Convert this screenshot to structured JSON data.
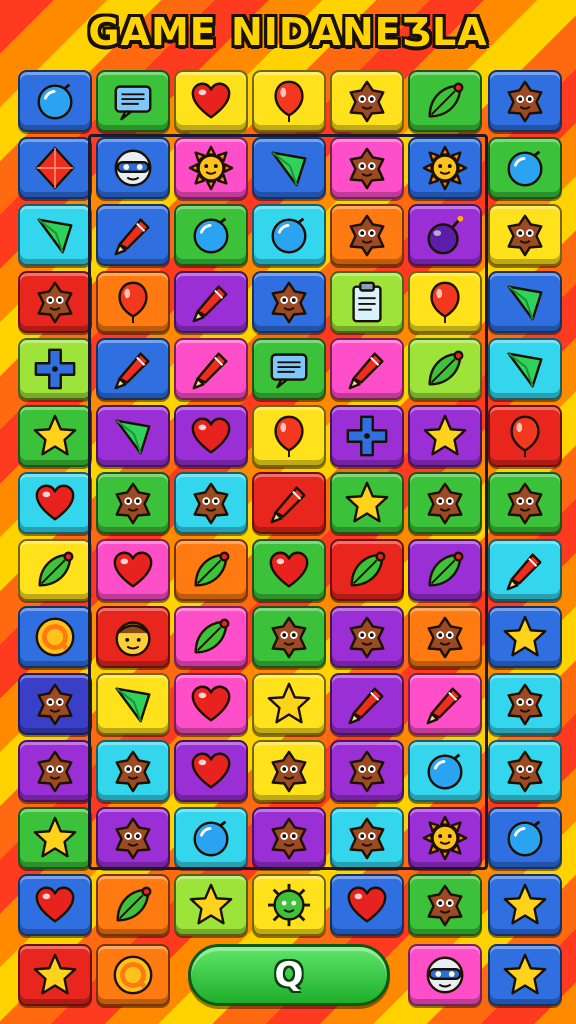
{
  "header": {
    "title": "GAME NIDANEƷLA"
  },
  "colors": {
    "blue": "#2f6fe0",
    "green": "#3cc23a",
    "yellow": "#ffe21c",
    "red": "#e8261e",
    "orange": "#ff7a10",
    "cyan": "#34d6ee",
    "pink": "#ff4fc8",
    "purple": "#9b2fd6",
    "lime": "#9ee33a",
    "navy": "#3a3fc8",
    "violet": "#7a2fd0"
  },
  "grid": {
    "rows": [
      [
        "blue:bubble",
        "green:chat",
        "yellow:heart",
        "yellow:balloon",
        "yellow:cookie",
        "green:leaf",
        "blue:cookie"
      ],
      [
        "blue:diamond",
        "blue:robot",
        "pink:sun",
        "blue:gem",
        "pink:cookie",
        "blue:sun",
        "green:bubble"
      ],
      [
        "cyan:gem",
        "blue:crayon",
        "green:bubble",
        "cyan:bubble",
        "orange:cookie",
        "purple:bomb",
        "yellow:cookie"
      ],
      [
        "red:cookie",
        "orange:balloon",
        "purple:crayon",
        "blue:cookie",
        "lime:clipboard",
        "yellow:balloon",
        "blue:gem"
      ],
      [
        "lime:plus",
        "blue:crayon",
        "pink:crayon",
        "green:chat",
        "pink:crayon",
        "lime:leaf",
        "cyan:gem"
      ],
      [
        "green:star",
        "purple:gem",
        "purple:heart",
        "yellow:balloon",
        "purple:plus",
        "purple:star",
        "red:balloon"
      ],
      [
        "cyan:heart",
        "green:cookie",
        "cyan:cookie",
        "red:crayon",
        "green:star",
        "green:cookie",
        "green:cookie"
      ],
      [
        "yellow:leaf",
        "pink:heart",
        "orange:leaf",
        "green:heart",
        "red:leaf",
        "purple:leaf",
        "cyan:crayon"
      ],
      [
        "blue:coin",
        "red:face",
        "pink:leaf",
        "green:cookie",
        "purple:cookie",
        "orange:cookie",
        "blue:star"
      ],
      [
        "navy:cookie",
        "yellow:gem",
        "pink:heart",
        "yellow:star",
        "purple:crayon",
        "pink:crayon",
        "cyan:cookie"
      ],
      [
        "purple:cookie",
        "cyan:cookie",
        "purple:heart",
        "yellow:cookie",
        "purple:cookie",
        "cyan:bubble",
        "cyan:cookie"
      ],
      [
        "green:star",
        "purple:cookie",
        "cyan:bubble",
        "purple:cookie",
        "cyan:cookie",
        "purple:sun",
        "blue:bubble"
      ],
      [
        "blue:heart",
        "orange:leaf",
        "lime:star",
        "yellow:virus",
        "blue:heart",
        "green:cookie",
        "blue:star"
      ]
    ]
  },
  "bottom": {
    "left_tiles": [
      "red:star",
      "orange:coin"
    ],
    "right_tiles": [
      "pink:robot",
      "blue:star"
    ],
    "action_label": "Q"
  }
}
